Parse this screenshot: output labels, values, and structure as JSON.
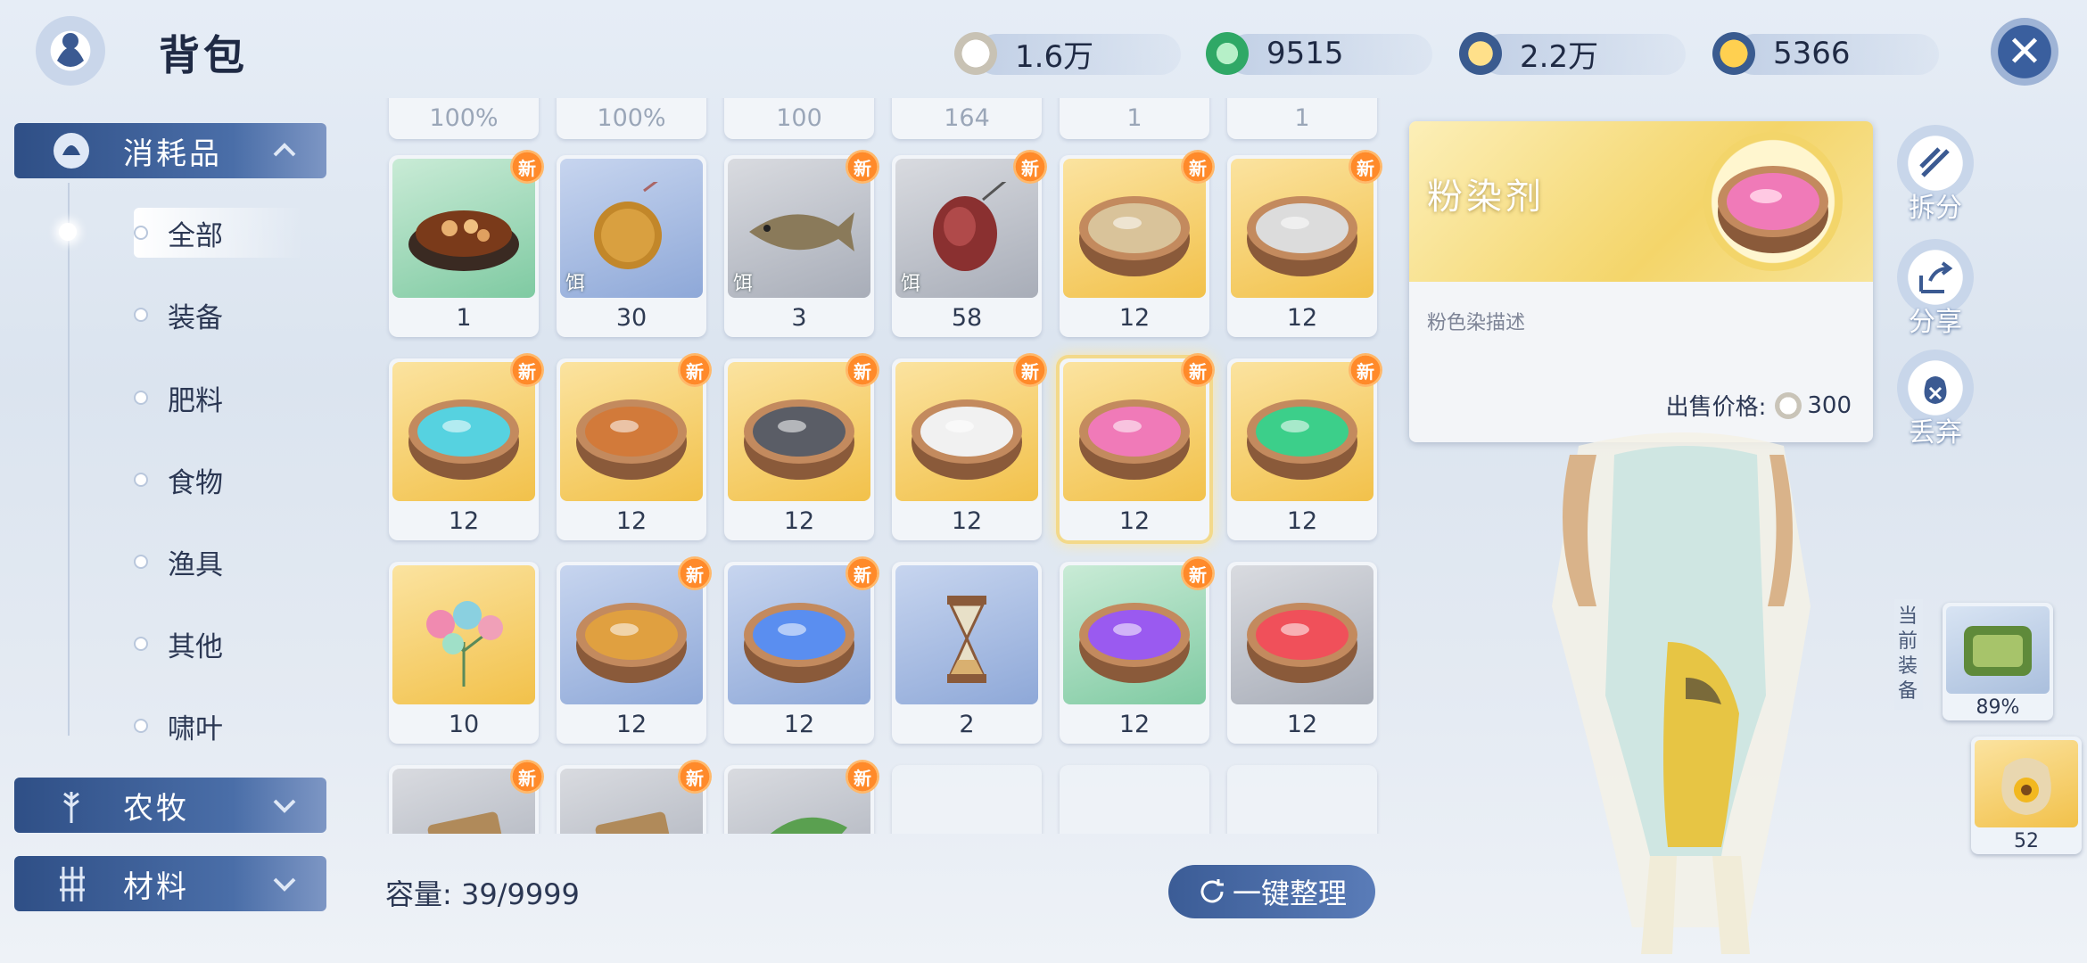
{
  "header": {
    "title": "背包"
  },
  "currencies": [
    {
      "name": "shell-coin",
      "value": "1.6万"
    },
    {
      "name": "jade-coin",
      "value": "9515"
    },
    {
      "name": "gold-bird-coin",
      "value": "2.2万"
    },
    {
      "name": "rooster-coin",
      "value": "5366"
    }
  ],
  "sidebar": {
    "categories": [
      {
        "label": "消耗品",
        "expanded": true
      },
      {
        "label": "农牧",
        "expanded": false
      },
      {
        "label": "材料",
        "expanded": false
      }
    ],
    "subcategories": [
      "全部",
      "装备",
      "肥料",
      "食物",
      "渔具",
      "其他",
      "啸叶"
    ],
    "active_sub": "全部"
  },
  "grid": {
    "partial_top": [
      "100%",
      "100%",
      "100",
      "164",
      "1",
      "1"
    ],
    "items": [
      {
        "name": "braised-dish",
        "count": "1",
        "bg": "green",
        "new": true
      },
      {
        "name": "meatball-bait",
        "count": "30",
        "bg": "blue",
        "new": false,
        "tag": "饵"
      },
      {
        "name": "fish-bait",
        "count": "3",
        "bg": "gray",
        "new": true,
        "tag": "饵"
      },
      {
        "name": "sausage-bait",
        "count": "58",
        "bg": "gray",
        "new": true,
        "tag": "饵"
      },
      {
        "name": "beige-dye",
        "count": "12",
        "bg": "gold",
        "new": true,
        "color": "#d9c39a"
      },
      {
        "name": "white-gray-dye",
        "count": "12",
        "bg": "gold",
        "new": true,
        "color": "#dcdcdc"
      },
      {
        "name": "cyan-dye",
        "count": "12",
        "bg": "gold",
        "new": true,
        "color": "#56d2e0"
      },
      {
        "name": "orange-dye",
        "count": "12",
        "bg": "gold",
        "new": true,
        "color": "#d27a3a"
      },
      {
        "name": "black-dye",
        "count": "12",
        "bg": "gold",
        "new": true,
        "color": "#5a5d66"
      },
      {
        "name": "white-dye",
        "count": "12",
        "bg": "gold",
        "new": true,
        "color": "#f1f1f1"
      },
      {
        "name": "pink-dye",
        "count": "12",
        "bg": "gold",
        "new": true,
        "color": "#f07ab8",
        "selected": true
      },
      {
        "name": "green-dye",
        "count": "12",
        "bg": "gold",
        "new": true,
        "color": "#3ccf8a"
      },
      {
        "name": "flower-bouquet",
        "count": "10",
        "bg": "gold",
        "new": false
      },
      {
        "name": "amber-dye",
        "count": "12",
        "bg": "blue",
        "new": true,
        "color": "#e0a040"
      },
      {
        "name": "blue-dye",
        "count": "12",
        "bg": "blue",
        "new": true,
        "color": "#5a8ef0"
      },
      {
        "name": "hourglass",
        "count": "2",
        "bg": "blue",
        "new": false
      },
      {
        "name": "violet-dye",
        "count": "12",
        "bg": "green",
        "new": true,
        "color": "#9a5af0"
      },
      {
        "name": "red-dye",
        "count": "12",
        "bg": "gray",
        "new": false,
        "color": "#f0505a"
      }
    ],
    "bottom_row": [
      {
        "name": "scroll-item",
        "new": true
      },
      {
        "name": "wood-item",
        "new": true
      },
      {
        "name": "leaf-item",
        "new": true
      }
    ],
    "new_badge": "新"
  },
  "capacity": {
    "label": "容量: 39/9999"
  },
  "sort_button": {
    "label": "一键整理"
  },
  "detail": {
    "name": "粉染剂",
    "description": "粉色染描述",
    "price_label": "出售价格:",
    "price": "300"
  },
  "actions": [
    {
      "name": "split",
      "label": "拆分"
    },
    {
      "name": "share",
      "label": "分享"
    },
    {
      "name": "discard",
      "label": "丢弃"
    }
  ],
  "equipment": {
    "label": "当前装备",
    "slots": [
      {
        "name": "money-bag",
        "value": "89%"
      },
      {
        "name": "seed-bag",
        "value": "52"
      }
    ]
  }
}
